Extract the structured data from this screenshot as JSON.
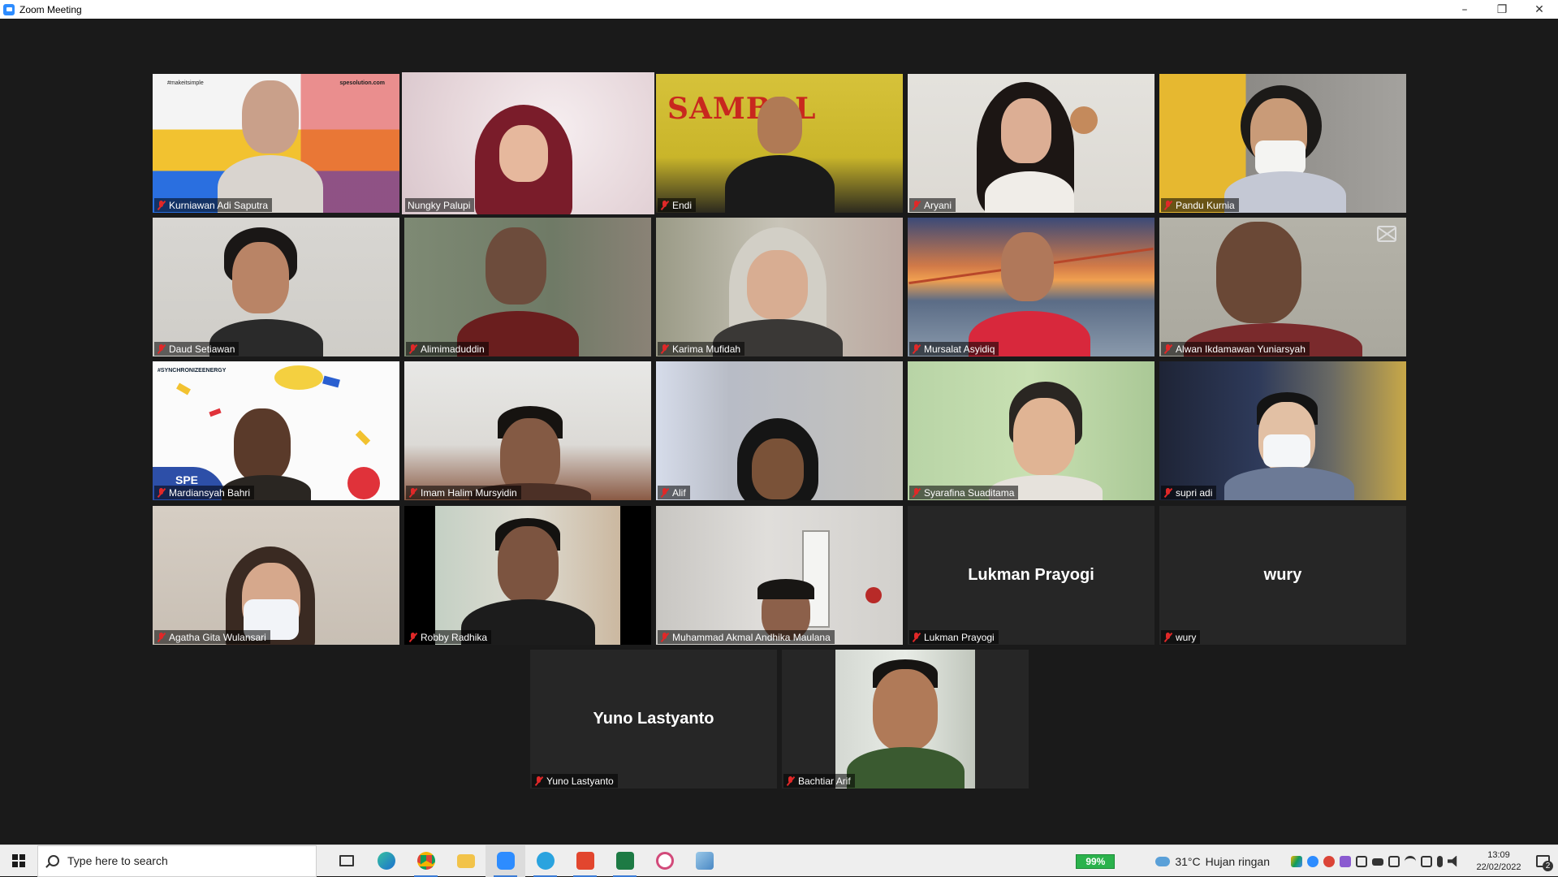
{
  "window": {
    "title": "Zoom Meeting",
    "minimize": "–",
    "restore": "❐",
    "close": "✕"
  },
  "participants": [
    {
      "name": "Kurniawan Adi Saputra",
      "video": true
    },
    {
      "name": "Nungky Palupi",
      "video": true,
      "active_speaker": true
    },
    {
      "name": "Endi",
      "video": true
    },
    {
      "name": "Aryani",
      "video": true
    },
    {
      "name": "Pandu Kurnia",
      "video": true
    },
    {
      "name": "Daud Setiawan",
      "video": true
    },
    {
      "name": "Alimimaduddin",
      "video": true
    },
    {
      "name": "Karima Mufidah",
      "video": true
    },
    {
      "name": "Mursalat Asyidiq",
      "video": true
    },
    {
      "name": "Alwan Ikdamawan Yuniarsyah",
      "video": true
    },
    {
      "name": "Mardiansyah Bahri",
      "video": true
    },
    {
      "name": "Imam Halim Mursyidin",
      "video": true
    },
    {
      "name": "Alif",
      "video": true
    },
    {
      "name": "Syarafina Suaditama",
      "video": true
    },
    {
      "name": "supri adi",
      "video": true
    },
    {
      "name": "Agatha Gita Wulansari",
      "video": true
    },
    {
      "name": "Robby Radhika",
      "video": true
    },
    {
      "name": "Muhammad Akmal Andhika Maulana",
      "video": true
    },
    {
      "name": "Lukman Prayogi",
      "video": false
    },
    {
      "name": "wury",
      "video": false
    },
    {
      "name": "Yuno Lastyanto",
      "video": false
    },
    {
      "name": "Bachtiar Arif",
      "video": true
    }
  ],
  "tile_text": {
    "kurniawan_tag": "#makeitsimple",
    "kurniawan_brand": "spesolution.com",
    "endi_banner": "SAMBAL",
    "mardiansyah_tag": "#SYNCHRONIZEENERGY",
    "mardiansyah_logo": "SPE"
  },
  "taskbar": {
    "search_placeholder": "Type here to search",
    "battery": "99%",
    "weather_temp": "31°C",
    "weather_desc": "Hujan ringan",
    "time": "13:09",
    "date": "22/02/2022",
    "notification_count": "2"
  }
}
